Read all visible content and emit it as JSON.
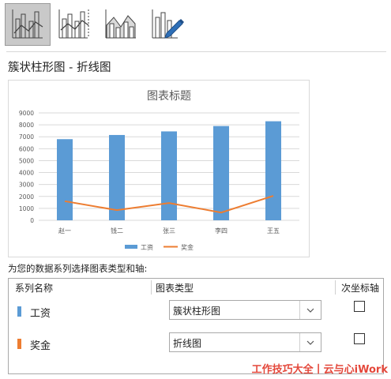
{
  "toolbar": {
    "buttons": [
      {
        "icon": "clustered-column-line-icon",
        "active": true
      },
      {
        "icon": "clustered-column-line-secondary-axis-icon",
        "active": false
      },
      {
        "icon": "stacked-area-column-icon",
        "active": false
      },
      {
        "icon": "custom-combination-icon",
        "active": false
      }
    ]
  },
  "combo_title": "簇状柱形图 - 折线图",
  "chart_data": {
    "type": "bar",
    "title": "图表标题",
    "categories": [
      "赵一",
      "钱二",
      "张三",
      "李四",
      "王五"
    ],
    "series": [
      {
        "name": "工资",
        "type": "bar",
        "color": "#5B9BD5",
        "values": [
          6800,
          7150,
          7450,
          7900,
          8300
        ]
      },
      {
        "name": "奖金",
        "type": "line",
        "color": "#ED7D31",
        "values": [
          1600,
          850,
          1450,
          650,
          2050
        ]
      }
    ],
    "ylim": [
      0,
      9000
    ],
    "yticks": [
      "0",
      "1000",
      "2000",
      "3000",
      "4000",
      "5000",
      "6000",
      "7000",
      "8000",
      "9000"
    ],
    "grid": true,
    "legend": "bottom"
  },
  "prompt": "为您的数据系列选择图表类型和轴:",
  "table": {
    "headers": {
      "name": "系列名称",
      "type": "图表类型",
      "secondary": "次坐标轴"
    },
    "rows": [
      {
        "name": "工资",
        "color": "#5B9BD5",
        "type": "簇状柱形图",
        "secondary": false
      },
      {
        "name": "奖金",
        "color": "#ED7D31",
        "type": "折线图",
        "secondary": false
      }
    ]
  },
  "watermark": "工作技巧大全丨云与心iWork"
}
